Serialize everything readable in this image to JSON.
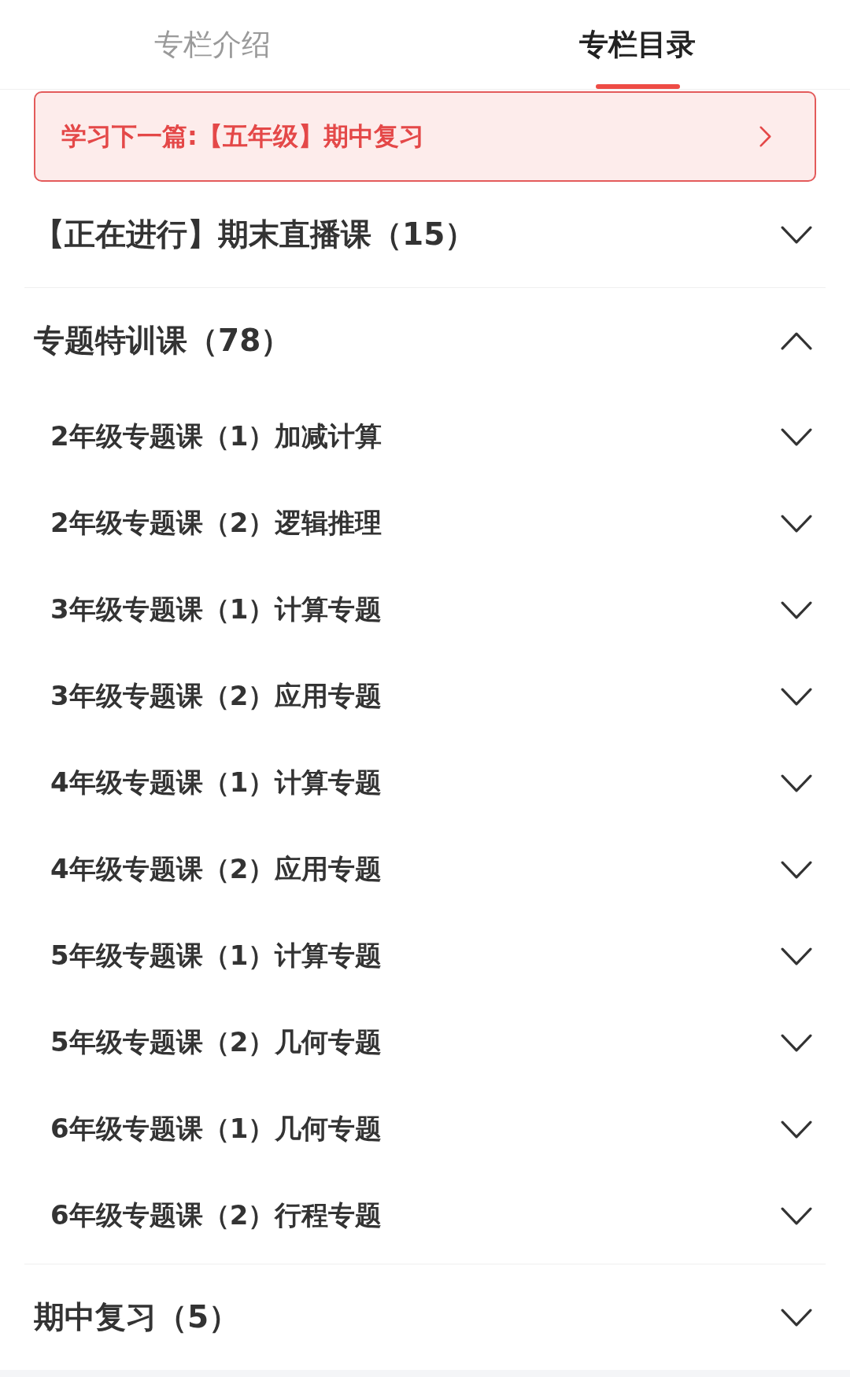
{
  "tabs": [
    {
      "label": "专栏介绍",
      "selected": false
    },
    {
      "label": "专栏目录",
      "selected": true
    }
  ],
  "next_banner": {
    "text": "学习下一篇:【五年级】期中复习"
  },
  "sections": [
    {
      "title": "【正在进行】期末直播课（15）",
      "expanded": false
    },
    {
      "title": "专题特训课（78）",
      "expanded": true,
      "children": [
        {
          "title": "2年级专题课（1）加减计算",
          "expanded": false
        },
        {
          "title": "2年级专题课（2）逻辑推理",
          "expanded": false
        },
        {
          "title": "3年级专题课（1）计算专题",
          "expanded": false
        },
        {
          "title": "3年级专题课（2）应用专题",
          "expanded": false
        },
        {
          "title": "4年级专题课（1）计算专题",
          "expanded": false
        },
        {
          "title": "4年级专题课（2）应用专题",
          "expanded": false
        },
        {
          "title": "5年级专题课（1）计算专题",
          "expanded": false
        },
        {
          "title": "5年级专题课（2）几何专题",
          "expanded": false
        },
        {
          "title": "6年级专题课（1）几何专题",
          "expanded": false
        },
        {
          "title": "6年级专题课（2）行程专题",
          "expanded": false
        }
      ]
    },
    {
      "title": "期中复习（5）",
      "expanded": false
    }
  ]
}
